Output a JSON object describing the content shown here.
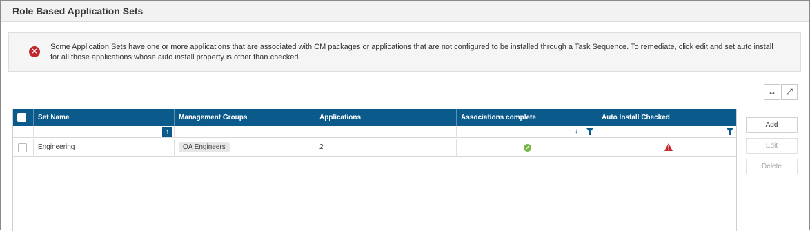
{
  "header": {
    "title": "Role Based Application Sets"
  },
  "alert": {
    "icon": "error-circle-icon",
    "message": "Some Application Sets have one or more applications that are associated with CM packages or applications that are not configured to be installed through a Task Sequence. To remediate, click edit and set auto install for all those applications whose auto install property is other than checked."
  },
  "view_controls": {
    "fit_width_icon": "↔",
    "expand_icon": "⤢"
  },
  "grid": {
    "columns": [
      "Set Name",
      "Management Groups",
      "Applications",
      "Associations complete",
      "Auto Install Checked"
    ],
    "rows": [
      {
        "set_name": "Engineering",
        "management_group": "QA Engineers",
        "applications": "2",
        "associations_complete": "check-icon",
        "auto_install_checked": "warning-icon"
      }
    ]
  },
  "actions": {
    "add": "Add",
    "edit": "Edit",
    "delete": "Delete"
  },
  "colors": {
    "header_blue": "#0b5a8c",
    "error_red": "#c4262e",
    "success_green": "#7ab648"
  }
}
